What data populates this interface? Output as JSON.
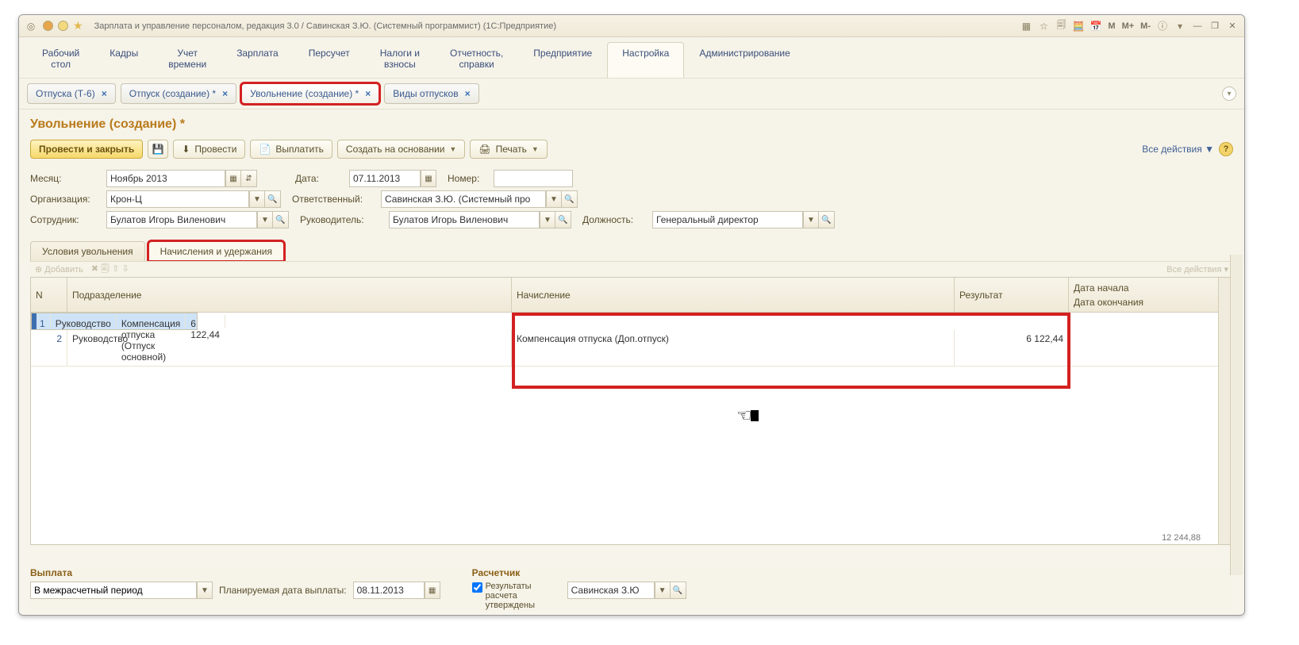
{
  "titlebar": {
    "title": "Зарплата и управление персоналом, редакция 3.0 / Савинская З.Ю. (Системный программист)  (1С:Предприятие)",
    "m": "M",
    "mplus": "M+",
    "mminus": "M-"
  },
  "mainmenu": [
    "Рабочий\nстол",
    "Кадры",
    "Учет\nвремени",
    "Зарплата",
    "Персучет",
    "Налоги и\nвзносы",
    "Отчетность,\nсправки",
    "Предприятие",
    "Настройка",
    "Администрирование"
  ],
  "mainmenu_active": 8,
  "doctabs": [
    {
      "label": "Отпуска (Т-6)",
      "closable": true
    },
    {
      "label": "Отпуск (создание) *",
      "closable": true
    },
    {
      "label": "Увольнение (создание) *",
      "closable": true,
      "highlight": true,
      "active": true
    },
    {
      "label": "Виды отпусков",
      "closable": true
    }
  ],
  "page_title": "Увольнение (создание) *",
  "toolbar": {
    "post_close": "Провести и закрыть",
    "post": "Провести",
    "pay": "Выплатить",
    "create_based": "Создать на основании",
    "print": "Печать",
    "all_actions": "Все действия"
  },
  "form": {
    "month_lbl": "Месяц:",
    "month_val": "Ноябрь 2013",
    "date_lbl": "Дата:",
    "date_val": "07.11.2013",
    "number_lbl": "Номер:",
    "number_val": "",
    "org_lbl": "Организация:",
    "org_val": "Крон-Ц",
    "resp_lbl": "Ответственный:",
    "resp_val": "Савинская З.Ю. (Системный про",
    "emp_lbl": "Сотрудник:",
    "emp_val": "Булатов Игорь Виленович",
    "mgr_lbl": "Руководитель:",
    "mgr_val": "Булатов Игорь Виленович",
    "pos_lbl": "Должность:",
    "pos_val": "Генеральный директор"
  },
  "subtabs": [
    {
      "label": "Условия увольнения"
    },
    {
      "label": "Начисления и удержания",
      "active": true,
      "highlight": true
    }
  ],
  "innerbar": {
    "add": "Добавить",
    "right": "Все действия"
  },
  "table": {
    "headers": {
      "n": "N",
      "dep": "Подразделение",
      "acc": "Начисление",
      "res": "Результат",
      "d1": "Дата начала",
      "d2": "Дата окончания"
    },
    "rows": [
      {
        "n": "1",
        "dep": "Руководство",
        "acc": "Компенсация отпуска (Отпуск основной)",
        "res": "6 122,44",
        "sel": true
      },
      {
        "n": "2",
        "dep": "Руководство",
        "acc": "Компенсация отпуска (Доп.отпуск)",
        "res": "6 122,44"
      }
    ],
    "total": "12 244,88"
  },
  "bottom": {
    "pay_title": "Выплата",
    "pay_mode": "В межрасчетный период",
    "plan_lbl": "Планируемая дата выплаты:",
    "plan_date": "08.11.2013",
    "calc_title": "Расчетчик",
    "approved": "Результаты расчета утверждены",
    "calc_name": "Савинская З.Ю"
  }
}
